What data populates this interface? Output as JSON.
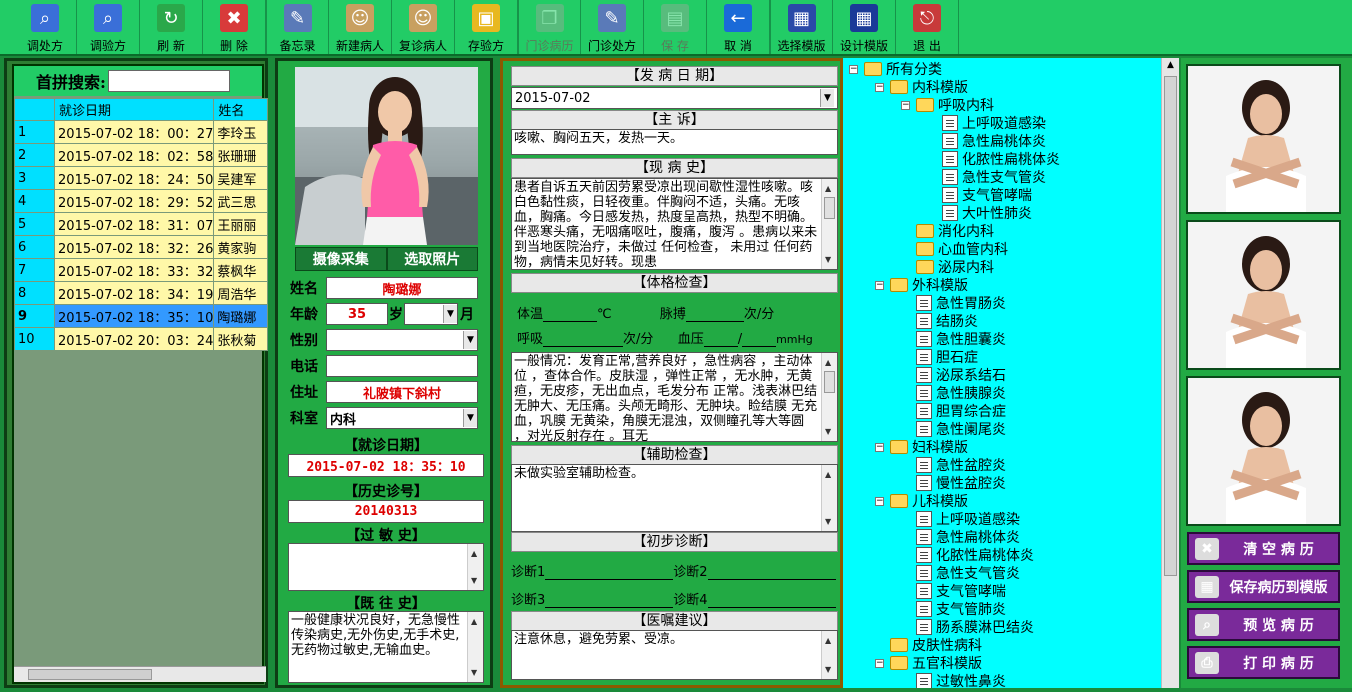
{
  "toolbar": {
    "buttons": [
      {
        "label": "调处方",
        "icon": "magnifier-icon",
        "disabled": false
      },
      {
        "label": "调验方",
        "icon": "magnifier-doc-icon",
        "disabled": false
      },
      {
        "label": "刷 新",
        "icon": "refresh-icon",
        "disabled": false
      },
      {
        "label": "删 除",
        "icon": "delete-icon",
        "disabled": false
      },
      {
        "label": "备忘录",
        "icon": "memo-icon",
        "disabled": false
      },
      {
        "label": "新建病人",
        "icon": "new-patient-icon",
        "disabled": false
      },
      {
        "label": "复诊病人",
        "icon": "revisit-patient-icon",
        "disabled": false
      },
      {
        "label": "存验方",
        "icon": "save-folder-icon",
        "disabled": false
      },
      {
        "label": "门诊病历",
        "icon": "copy-icon",
        "disabled": true
      },
      {
        "label": "门诊处方",
        "icon": "edit-doc-icon",
        "disabled": false
      },
      {
        "label": "保 存",
        "icon": "save-icon",
        "disabled": true
      },
      {
        "label": "取 消",
        "icon": "cancel-arrow-icon",
        "disabled": false
      },
      {
        "label": "选择模版",
        "icon": "select-template-icon",
        "disabled": false
      },
      {
        "label": "设计模版",
        "icon": "design-template-icon",
        "disabled": false
      },
      {
        "label": "退 出",
        "icon": "exit-door-icon",
        "disabled": false
      }
    ]
  },
  "search": {
    "label": "首拼搜索:",
    "value": ""
  },
  "patients": {
    "columns": [
      "",
      "就诊日期",
      "姓名"
    ],
    "rows": [
      {
        "n": "1",
        "date": "2015-07-02 18：00：27",
        "name": "李玲玉"
      },
      {
        "n": "2",
        "date": "2015-07-02 18：02：58",
        "name": "张珊珊"
      },
      {
        "n": "3",
        "date": "2015-07-02 18：24：50",
        "name": "吴建军"
      },
      {
        "n": "4",
        "date": "2015-07-02 18：29：52",
        "name": "武三思"
      },
      {
        "n": "5",
        "date": "2015-07-02 18：31：07",
        "name": "王丽丽"
      },
      {
        "n": "6",
        "date": "2015-07-02 18：32：26",
        "name": "黄家驹"
      },
      {
        "n": "7",
        "date": "2015-07-02 18：33：32",
        "name": "蔡枫华"
      },
      {
        "n": "8",
        "date": "2015-07-02 18：34：19",
        "name": "周浩华"
      },
      {
        "n": "9",
        "date": "2015-07-02 18：35：10",
        "name": "陶璐娜"
      },
      {
        "n": "10",
        "date": "2015-07-02 20：03：24",
        "name": "张秋菊"
      }
    ],
    "selected_index": 8
  },
  "patient": {
    "capture_btn": "摄像采集",
    "pick_photo_btn": "选取照片",
    "name_label": "姓名",
    "name": "陶璐娜",
    "age_label": "年龄",
    "age": "35",
    "age_unit": "岁",
    "month_unit": "月",
    "sex_label": "性别",
    "sex": "",
    "phone_label": "电话",
    "phone": "",
    "address_label": "住址",
    "address": "礼陂镇下斜村",
    "dept_label": "科室",
    "dept": "内科",
    "visit_date_title": "【就诊日期】",
    "visit_date": "2015-07-02 18：35：10",
    "history_no_title": "【历史诊号】",
    "history_no": "20140313",
    "allergy_title": "【过 敏 史】",
    "allergy": "",
    "past_title": "【既 往 史】",
    "past": "一般健康状况良好，无急慢性传染病史,无外伤史,无手术史,无药物过敏史,无输血史。"
  },
  "record": {
    "onset_title": "【发 病 日 期】",
    "onset": "2015-07-02",
    "complaint_title": "【主 诉】",
    "complaint": "咳嗽、胸闷五天，发热一天。",
    "present_title": "【现 病 史】",
    "present": "患者自诉五天前因劳累受凉出现间歇性湿性咳嗽。咳白色黏性痰，日轻夜重。伴胸闷不适，头痛。无咳血，胸痛。今日感发热，热度呈高热，热型不明确。伴恶寒头痛，无咽痛呕吐，腹痛，腹泻 。患病以来未到当地医院治疗，未做过 任何检查， 未用过  任何药物，病情未见好转。现患",
    "exam_title": "【体格检查】",
    "vitals": {
      "temp": "体温",
      "temp_unit": "℃",
      "pulse": "脉搏",
      "pulse_unit": "次/分",
      "resp": "呼吸",
      "resp_unit": "次/分",
      "bp": "血压",
      "bp_sep": "/",
      "bp_unit": "mmHg"
    },
    "exam": "一般情况：发育正常,营养良好 ，急性病容 ，主动体位 ，查体合作。皮肤湿 ，弹性正常 ，无水肿，无黄疸，无皮疹，无出血点，毛发分布 正常。浅表淋巴结无肿大、无压痛。头颅无畸形、无肿块。睑结膜 无充血，巩膜 无黄染，角膜无混浊，双侧瞳孔等大等圆 ，对光反射存在 。耳无",
    "aux_title": "【辅助检查】",
    "aux": "未做实验室辅助检查。",
    "diag_title": "【初步诊断】",
    "diag_labels": [
      "诊断1",
      "诊断2",
      "诊断3",
      "诊断4"
    ],
    "advice_title": "【医嘱建议】",
    "advice": "注意休息，避免劳累、受凉。"
  },
  "tree": {
    "nodes": [
      {
        "label": "所有分类",
        "level": 0,
        "type": "folder",
        "toggle": "-"
      },
      {
        "label": "内科模版",
        "level": 1,
        "type": "folder",
        "toggle": "-"
      },
      {
        "label": "呼吸内科",
        "level": 2,
        "type": "folder",
        "toggle": "-"
      },
      {
        "label": "上呼吸道感染",
        "level": 3,
        "type": "doc"
      },
      {
        "label": "急性扁桃体炎",
        "level": 3,
        "type": "doc"
      },
      {
        "label": "化脓性扁桃体炎",
        "level": 3,
        "type": "doc"
      },
      {
        "label": "急性支气管炎",
        "level": 3,
        "type": "doc"
      },
      {
        "label": "支气管哮喘",
        "level": 3,
        "type": "doc"
      },
      {
        "label": "大叶性肺炎",
        "level": 3,
        "type": "doc"
      },
      {
        "label": "消化内科",
        "level": 2,
        "type": "folder"
      },
      {
        "label": "心血管内科",
        "level": 2,
        "type": "folder"
      },
      {
        "label": "泌尿内科",
        "level": 2,
        "type": "folder"
      },
      {
        "label": "外科模版",
        "level": 1,
        "type": "folder",
        "toggle": "-"
      },
      {
        "label": "急性胃肠炎",
        "level": 2,
        "type": "doc"
      },
      {
        "label": "结肠炎",
        "level": 2,
        "type": "doc"
      },
      {
        "label": "急性胆囊炎",
        "level": 2,
        "type": "doc"
      },
      {
        "label": "胆石症",
        "level": 2,
        "type": "doc"
      },
      {
        "label": "泌尿系结石",
        "level": 2,
        "type": "doc"
      },
      {
        "label": "急性胰腺炎",
        "level": 2,
        "type": "doc"
      },
      {
        "label": "胆胃综合症",
        "level": 2,
        "type": "doc"
      },
      {
        "label": "急性阑尾炎",
        "level": 2,
        "type": "doc"
      },
      {
        "label": "妇科模版",
        "level": 1,
        "type": "folder",
        "toggle": "-"
      },
      {
        "label": "急性盆腔炎",
        "level": 2,
        "type": "doc"
      },
      {
        "label": "慢性盆腔炎",
        "level": 2,
        "type": "doc"
      },
      {
        "label": "儿科模版",
        "level": 1,
        "type": "folder",
        "toggle": "-"
      },
      {
        "label": "上呼吸道感染",
        "level": 2,
        "type": "doc"
      },
      {
        "label": "急性扁桃体炎",
        "level": 2,
        "type": "doc"
      },
      {
        "label": "化脓性扁桃体炎",
        "level": 2,
        "type": "doc"
      },
      {
        "label": "急性支气管炎",
        "level": 2,
        "type": "doc"
      },
      {
        "label": "支气管哮喘",
        "level": 2,
        "type": "doc"
      },
      {
        "label": "支气管肺炎",
        "level": 2,
        "type": "doc"
      },
      {
        "label": "肠系膜淋巴结炎",
        "level": 2,
        "type": "doc"
      },
      {
        "label": "皮肤性病科",
        "level": 1,
        "type": "folder"
      },
      {
        "label": "五官科模版",
        "level": 1,
        "type": "folder",
        "toggle": "-"
      },
      {
        "label": "过敏性鼻炎",
        "level": 2,
        "type": "doc"
      }
    ]
  },
  "actions": [
    {
      "label": "清 空 病 历",
      "icon": "clear-record-icon"
    },
    {
      "label": "保存病历到模版",
      "icon": "save-template-icon"
    },
    {
      "label": "预 览 病 历",
      "icon": "preview-icon"
    },
    {
      "label": "打 印 病 历",
      "icon": "print-icon"
    }
  ]
}
